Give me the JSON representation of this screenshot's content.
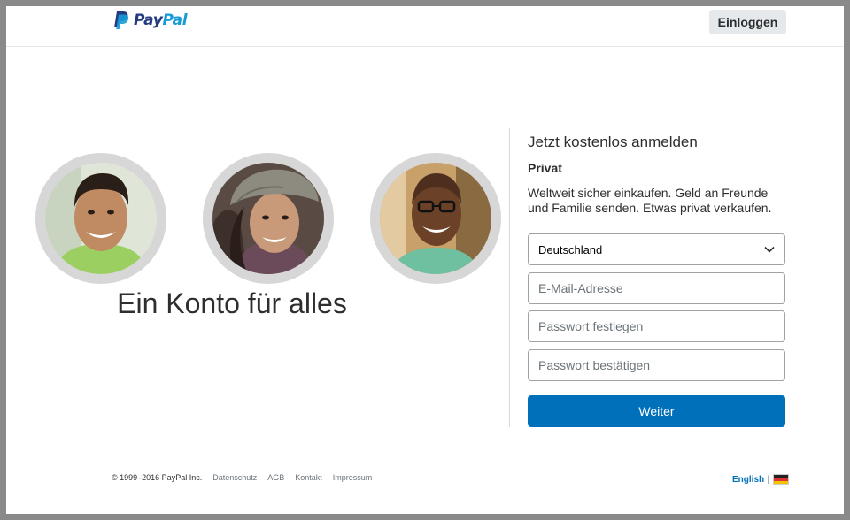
{
  "header": {
    "logo_pay": "Pay",
    "logo_pal": "Pal",
    "login_label": "Einloggen"
  },
  "hero": {
    "title": "Ein Konto für alles"
  },
  "signup": {
    "title": "Jetzt kostenlos anmelden",
    "account_type": "Privat",
    "description": "Weltweit sicher einkaufen. Geld an Freunde und Familie senden. Etwas privat verkaufen.",
    "country": "Deutschland",
    "email_placeholder": "E-Mail-Adresse",
    "password_placeholder": "Passwort festlegen",
    "password_confirm_placeholder": "Passwort bestätigen",
    "submit_label": "Weiter"
  },
  "footer": {
    "copyright": "© 1999–2016 PayPal Inc.",
    "links": [
      "Datenschutz",
      "AGB",
      "Kontakt",
      "Impressum"
    ],
    "language": "English",
    "separator": "|"
  },
  "colors": {
    "brand_dark": "#253b80",
    "brand_light": "#179bd7",
    "primary_button": "#0070ba",
    "secondary_button": "#e6e9ec"
  },
  "icons": [
    "paypal-logo-icon",
    "chevron-down-icon",
    "german-flag-icon"
  ]
}
